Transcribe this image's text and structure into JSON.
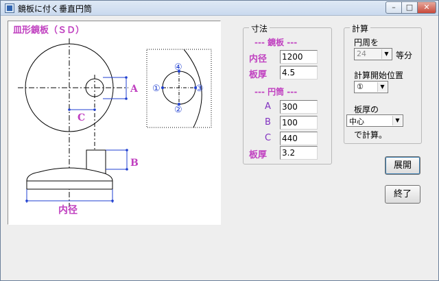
{
  "window": {
    "title": "鏡板に付く垂直円筒",
    "controls": {
      "minimize": "–",
      "maximize": "□",
      "close": "✕"
    }
  },
  "drawing": {
    "title": "皿形鏡板（ＳＤ）",
    "label_A": "A",
    "label_B": "B",
    "label_C": "C",
    "label_inner_dia": "内径",
    "positions": {
      "p1": "①",
      "p2": "②",
      "p3": "③",
      "p4": "④"
    }
  },
  "dimensions": {
    "group_title": "寸法",
    "head_section": "--- 鏡板 ---",
    "inner_dia_label": "内径",
    "inner_dia_value": "1200",
    "head_thickness_label": "板厚",
    "head_thickness_value": "4.5",
    "cylinder_section": "--- 円筒 ---",
    "a_label": "A",
    "a_value": "300",
    "b_label": "B",
    "b_value": "100",
    "c_label": "C",
    "c_value": "440",
    "cyl_thickness_label": "板厚",
    "cyl_thickness_value": "3.2"
  },
  "calculation": {
    "group_title": "計算",
    "circumference_label": "円周を",
    "divisions_value": "24",
    "divisions_unit": "等分",
    "start_position_label": "計算開始位置",
    "start_position_value": "①",
    "thickness_of_label": "板厚の",
    "thickness_basis_value": "中心",
    "calc_suffix": "で計算。"
  },
  "buttons": {
    "expand": "展開",
    "exit": "終了"
  },
  "colors": {
    "drawing_line": "#000000",
    "dimension_blue": "#1f3fd0",
    "label_magenta": "#c040c0"
  }
}
